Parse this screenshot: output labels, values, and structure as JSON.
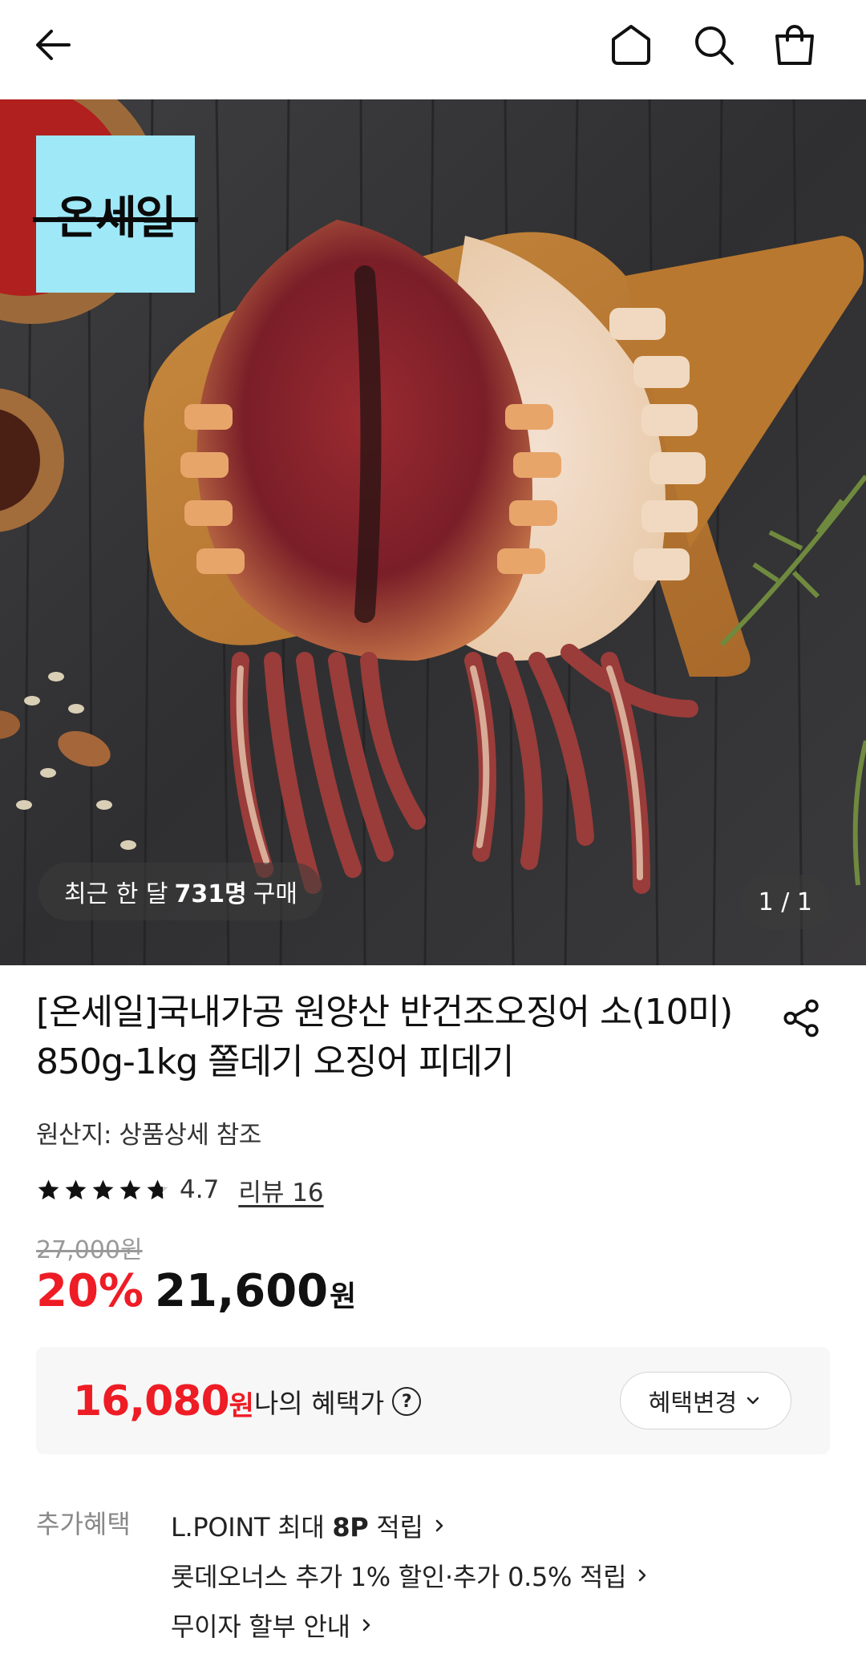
{
  "header": {
    "back_icon": "arrow-left-icon",
    "home_icon": "home-icon",
    "search_icon": "search-icon",
    "cart_icon": "shopping-bag-icon"
  },
  "hero": {
    "brand_badge": "온세일",
    "brand_badge_color": "#9ee8f8",
    "sales_prefix": "최근 한 달",
    "sales_count": "731명",
    "sales_suffix": "구매",
    "page_indicator": "1 / 1"
  },
  "product": {
    "title": "[온세일]국내가공 원양산 반건조오징어 소(10미) 850g-1kg 쫄데기 오징어 피데기",
    "origin": "원산지: 상품상세 참조",
    "rating": "4.7",
    "rating_stars": 4.7,
    "review_link": "리뷰 16",
    "original_price": "27,000원",
    "discount_rate": "20%",
    "sale_price": "21,600",
    "sale_unit": "원",
    "accent_color": "#ee1c25"
  },
  "benefit": {
    "amount": "16,080",
    "unit": "원",
    "label": "나의 혜택가",
    "help_icon": "question-circle-icon",
    "change_button": "혜택변경"
  },
  "extra": {
    "label": "추가혜택",
    "items": [
      {
        "pre": "L.POINT 최대 ",
        "bold": "8P",
        "post": " 적립"
      },
      {
        "pre": "롯데오너스 추가 1% 할인·추가 0.5% 적립",
        "bold": "",
        "post": ""
      },
      {
        "pre": "무이자 할부 안내",
        "bold": "",
        "post": ""
      }
    ]
  }
}
